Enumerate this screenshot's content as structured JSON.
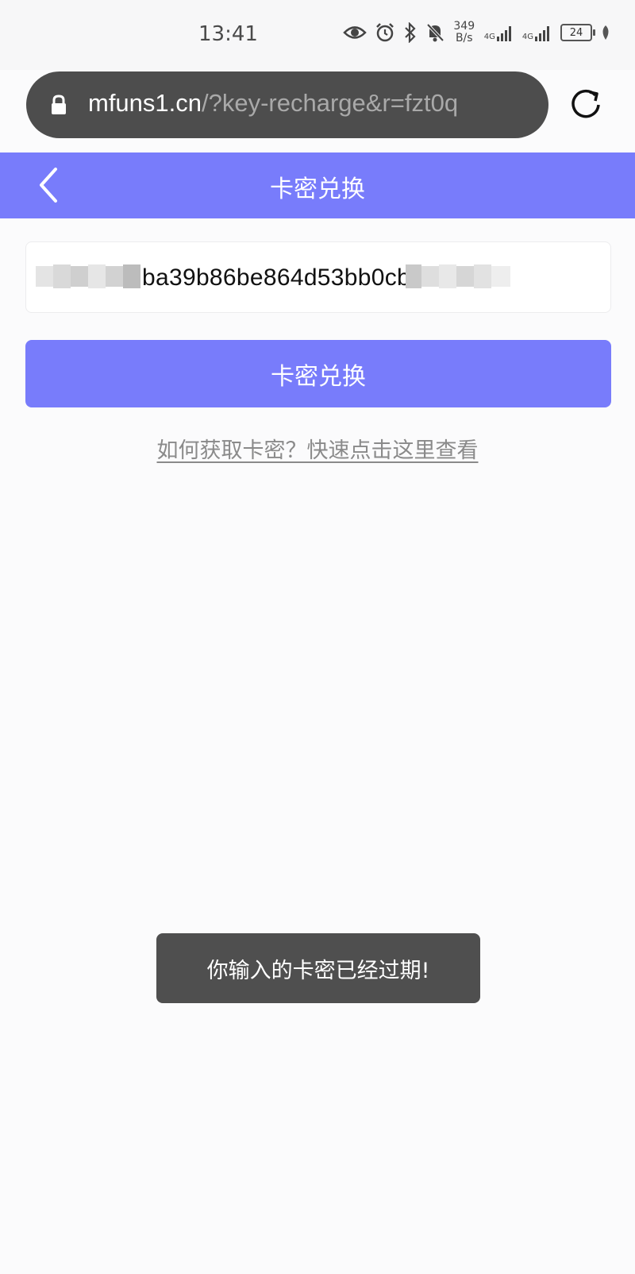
{
  "status_bar": {
    "time": "13:41",
    "net_speed_value": "349",
    "net_speed_unit": "B/s",
    "sim1_label": "4G",
    "sim2_label": "4G",
    "battery": "24"
  },
  "browser": {
    "url_domain": "mfuns1.cn",
    "url_path": "/?key-recharge&r=fzt0q"
  },
  "header": {
    "title": "卡密兑换"
  },
  "form": {
    "card_key_visible": "ba39b86be864d53bb0cb",
    "redeem_label": "卡密兑换",
    "help_link": "如何获取卡密？快速点击这里查看"
  },
  "toast": {
    "message": "你输入的卡密已经过期!"
  },
  "colors": {
    "accent": "#787cfb",
    "toast_bg": "#4f4f4f",
    "url_bar_bg": "#4d4d4d"
  }
}
